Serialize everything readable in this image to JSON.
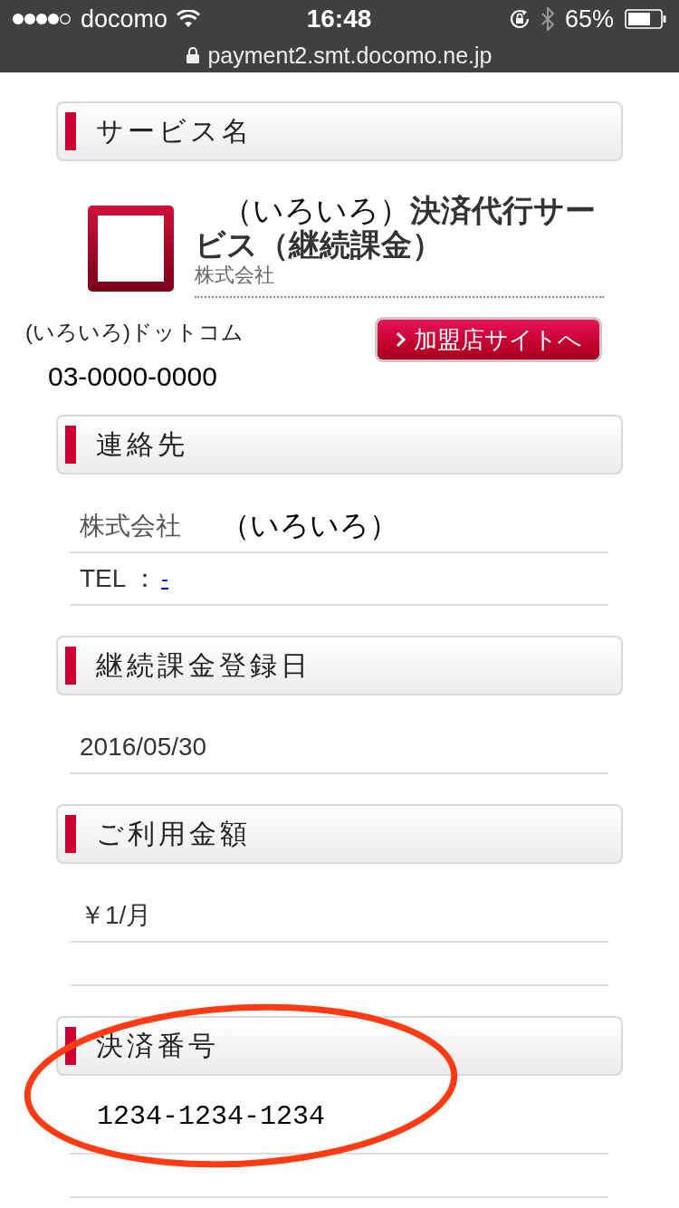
{
  "status_bar": {
    "carrier": "docomo",
    "time": "16:48",
    "battery": "65%",
    "url": "payment2.smt.docomo.ne.jp"
  },
  "sections": [
    {
      "kind": "service",
      "heading": "サービス名",
      "title": "（いろいろ）**決済代行サービス（継続課金）**",
      "company": "株式会社",
      "merchant_name": "(いろいろ)ドットコム",
      "phone": "03-0000-0000",
      "button": "加盟店サイトへ"
    },
    {
      "kind": "list",
      "heading": "連絡先",
      "rows": [
        {
          "kind": "pair",
          "label": "株式会社",
          "value": "（いろいろ）"
        },
        {
          "kind": "tel",
          "label": "TEL ：",
          "link": "-"
        }
      ]
    },
    {
      "kind": "list",
      "heading": "継続課金登録日",
      "rows": [
        {
          "kind": "text",
          "value": "2016/05/30"
        }
      ]
    },
    {
      "kind": "list",
      "heading": "ご利用金額",
      "rows": [
        {
          "kind": "text",
          "value": "￥1/月"
        },
        {
          "kind": "blank"
        }
      ]
    },
    {
      "kind": "list",
      "heading": "決済番号",
      "rows": [
        {
          "kind": "code",
          "value": "1234-1234-1234"
        },
        {
          "kind": "blank"
        }
      ]
    }
  ]
}
